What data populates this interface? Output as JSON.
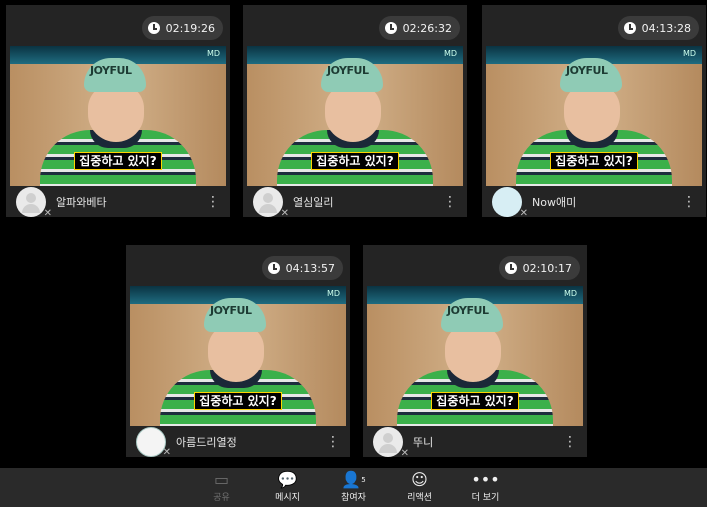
{
  "tiles": [
    {
      "timer": "02:19:26",
      "subtitle": "집중하고 있지?",
      "cap_text": "JOYFUL",
      "name": "알파와베타",
      "avatar": "placeholder"
    },
    {
      "timer": "02:26:32",
      "subtitle": "집중하고 있지?",
      "cap_text": "JOYFUL",
      "name": "열심일리",
      "avatar": "placeholder"
    },
    {
      "timer": "04:13:28",
      "subtitle": "집중하고 있지?",
      "cap_text": "JOYFUL",
      "name": "Now애미",
      "avatar": "custom"
    },
    {
      "timer": "04:13:57",
      "subtitle": "집중하고 있지?",
      "cap_text": "JOYFUL",
      "name": "아름드리열정",
      "avatar": "logo"
    },
    {
      "timer": "02:10:17",
      "subtitle": "집중하고 있지?",
      "cap_text": "JOYFUL",
      "name": "뚜니",
      "avatar": "placeholder"
    }
  ],
  "toolbar": {
    "share": "공유",
    "message": "메시지",
    "participants": "참여자",
    "participants_count": "5",
    "reaction": "리액션",
    "more": "더 보기"
  },
  "icons": {
    "timer": "clock-icon",
    "more": "more-vertical-icon",
    "mute": "mic-off-icon",
    "share": "share-screen-icon",
    "message": "chat-bubble-icon",
    "participants": "person-icon",
    "reaction": "smile-icon",
    "toolbar_more": "more-horizontal-icon"
  }
}
